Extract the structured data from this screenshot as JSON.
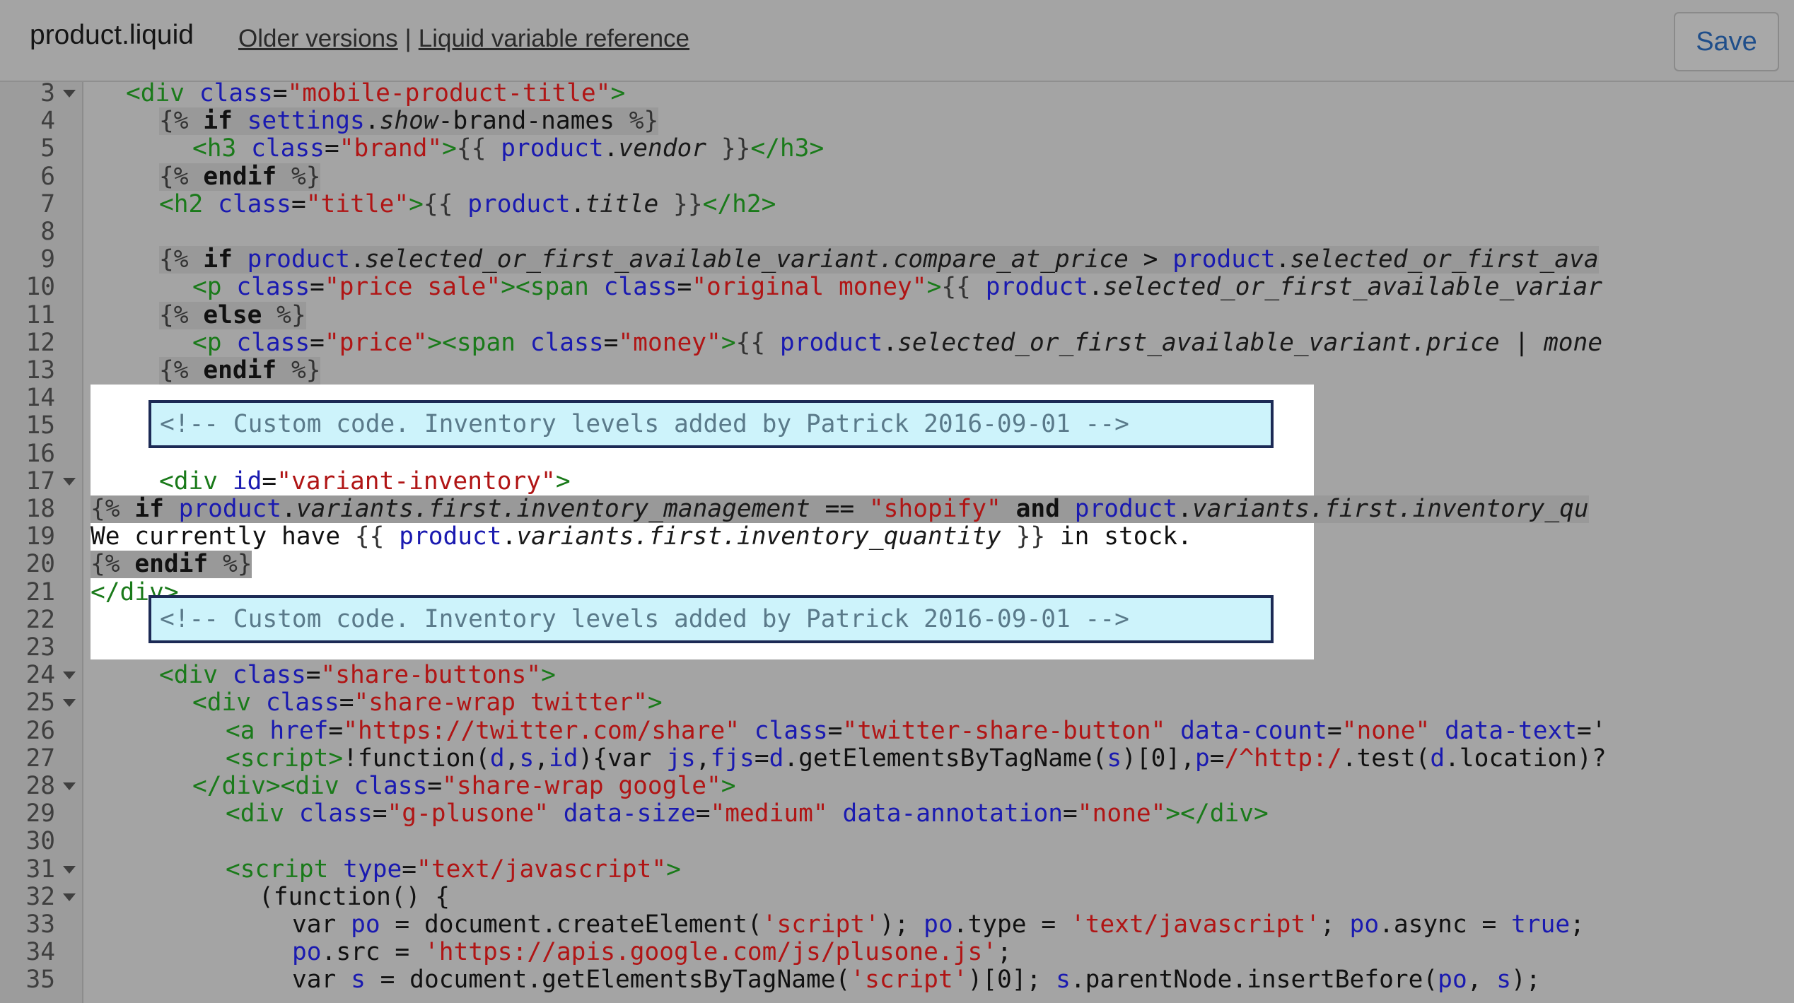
{
  "header": {
    "file_name": "product.liquid",
    "older_versions_label": "Older versions",
    "separator": "|",
    "liquid_reference_label": "Liquid variable reference",
    "save_label": "Save"
  },
  "lines": [
    {
      "n": "3",
      "fold": true,
      "parts": [
        [
          "t",
          "<div "
        ],
        [
          "a",
          "class"
        ],
        [
          "x",
          "="
        ],
        [
          "s",
          "\"mobile-product-title\""
        ],
        [
          "t",
          ">"
        ]
      ],
      "indent": 1
    },
    {
      "n": "4",
      "fold": false,
      "parts": [
        [
          "d",
          "{% "
        ],
        [
          "k",
          "if "
        ],
        [
          "v",
          "settings"
        ],
        [
          "x",
          "."
        ],
        [
          "p",
          "show"
        ],
        [
          "x",
          "-brand-names "
        ],
        [
          "d",
          "%}"
        ]
      ],
      "indent": 2,
      "bg": true
    },
    {
      "n": "5",
      "fold": false,
      "parts": [
        [
          "t",
          "<h3 "
        ],
        [
          "a",
          "class"
        ],
        [
          "x",
          "="
        ],
        [
          "s",
          "\"brand\""
        ],
        [
          "t",
          ">"
        ],
        [
          "d",
          "{{ "
        ],
        [
          "v",
          "product"
        ],
        [
          "x",
          "."
        ],
        [
          "p",
          "vendor"
        ],
        [
          "d",
          " }}"
        ],
        [
          "t",
          "</h3>"
        ]
      ],
      "indent": 3
    },
    {
      "n": "6",
      "fold": false,
      "parts": [
        [
          "d",
          "{% "
        ],
        [
          "k",
          "endif "
        ],
        [
          "d",
          "%}"
        ]
      ],
      "indent": 2,
      "bg": true
    },
    {
      "n": "7",
      "fold": false,
      "parts": [
        [
          "t",
          "<h2 "
        ],
        [
          "a",
          "class"
        ],
        [
          "x",
          "="
        ],
        [
          "s",
          "\"title\""
        ],
        [
          "t",
          ">"
        ],
        [
          "d",
          "{{ "
        ],
        [
          "v",
          "product"
        ],
        [
          "x",
          "."
        ],
        [
          "p",
          "title"
        ],
        [
          "d",
          " }}"
        ],
        [
          "t",
          "</h2>"
        ]
      ],
      "indent": 2
    },
    {
      "n": "8",
      "fold": false,
      "parts": [],
      "indent": 0
    },
    {
      "n": "9",
      "fold": false,
      "parts": [
        [
          "d",
          "{% "
        ],
        [
          "k",
          "if "
        ],
        [
          "v",
          "product"
        ],
        [
          "x",
          "."
        ],
        [
          "p",
          "selected_or_first_available_variant.compare_at_price"
        ],
        [
          "x",
          " > "
        ],
        [
          "v",
          "product"
        ],
        [
          "x",
          "."
        ],
        [
          "p",
          "selected_or_first_ava"
        ]
      ],
      "indent": 2,
      "bg": true
    },
    {
      "n": "10",
      "fold": false,
      "parts": [
        [
          "t",
          "<p "
        ],
        [
          "a",
          "class"
        ],
        [
          "x",
          "="
        ],
        [
          "s",
          "\"price sale\""
        ],
        [
          "t",
          ">"
        ],
        [
          "t",
          "<span "
        ],
        [
          "a",
          "class"
        ],
        [
          "x",
          "="
        ],
        [
          "s",
          "\"original money\""
        ],
        [
          "t",
          ">"
        ],
        [
          "d",
          "{{ "
        ],
        [
          "v",
          "product"
        ],
        [
          "x",
          "."
        ],
        [
          "p",
          "selected_or_first_available_variar"
        ]
      ],
      "indent": 3
    },
    {
      "n": "11",
      "fold": false,
      "parts": [
        [
          "d",
          "{% "
        ],
        [
          "k",
          "else "
        ],
        [
          "d",
          "%}"
        ]
      ],
      "indent": 2,
      "bg": true
    },
    {
      "n": "12",
      "fold": false,
      "parts": [
        [
          "t",
          "<p "
        ],
        [
          "a",
          "class"
        ],
        [
          "x",
          "="
        ],
        [
          "s",
          "\"price\""
        ],
        [
          "t",
          ">"
        ],
        [
          "t",
          "<span "
        ],
        [
          "a",
          "class"
        ],
        [
          "x",
          "="
        ],
        [
          "s",
          "\"money\""
        ],
        [
          "t",
          ">"
        ],
        [
          "d",
          "{{ "
        ],
        [
          "v",
          "product"
        ],
        [
          "x",
          "."
        ],
        [
          "p",
          "selected_or_first_available_variant.price"
        ],
        [
          "x",
          " | "
        ],
        [
          "p",
          "mone"
        ]
      ],
      "indent": 3
    },
    {
      "n": "13",
      "fold": false,
      "parts": [
        [
          "d",
          "{% "
        ],
        [
          "k",
          "endif "
        ],
        [
          "d",
          "%}"
        ]
      ],
      "indent": 2,
      "bg": true
    },
    {
      "n": "14",
      "fold": false,
      "parts": [],
      "indent": 0
    },
    {
      "n": "15",
      "fold": false,
      "parts": [],
      "indent": 0
    },
    {
      "n": "16",
      "fold": false,
      "parts": [],
      "indent": 0
    },
    {
      "n": "17",
      "fold": true,
      "parts": [
        [
          "t",
          "<div "
        ],
        [
          "a",
          "id"
        ],
        [
          "x",
          "="
        ],
        [
          "s",
          "\"variant-inventory\""
        ],
        [
          "t",
          ">"
        ]
      ],
      "indent": 2
    },
    {
      "n": "18",
      "fold": false,
      "parts": [
        [
          "d",
          "{% "
        ],
        [
          "k",
          "if "
        ],
        [
          "v",
          "product"
        ],
        [
          "x",
          "."
        ],
        [
          "p",
          "variants.first.inventory_management"
        ],
        [
          "x",
          " == "
        ],
        [
          "s",
          "\"shopify\""
        ],
        [
          "x",
          " "
        ],
        [
          "k",
          "and "
        ],
        [
          "v",
          "product"
        ],
        [
          "x",
          "."
        ],
        [
          "p",
          "variants.first.inventory_qu"
        ]
      ],
      "indent": 0,
      "bg": true
    },
    {
      "n": "19",
      "fold": false,
      "parts": [
        [
          "x",
          "We currently have "
        ],
        [
          "d",
          "{{ "
        ],
        [
          "v",
          "product"
        ],
        [
          "x",
          "."
        ],
        [
          "p",
          "variants.first.inventory_quantity"
        ],
        [
          "d",
          " }}"
        ],
        [
          "x",
          " in stock."
        ]
      ],
      "indent": 0
    },
    {
      "n": "20",
      "fold": false,
      "parts": [
        [
          "d",
          "{% "
        ],
        [
          "k",
          "endif "
        ],
        [
          "d",
          "%}"
        ]
      ],
      "indent": 0,
      "bg": true
    },
    {
      "n": "21",
      "fold": false,
      "parts": [
        [
          "t",
          "</div>"
        ]
      ],
      "indent": 0
    },
    {
      "n": "22",
      "fold": false,
      "parts": [],
      "indent": 0
    },
    {
      "n": "23",
      "fold": false,
      "parts": [],
      "indent": 0
    },
    {
      "n": "24",
      "fold": true,
      "parts": [
        [
          "t",
          "<div "
        ],
        [
          "a",
          "class"
        ],
        [
          "x",
          "="
        ],
        [
          "s",
          "\"share-buttons\""
        ],
        [
          "t",
          ">"
        ]
      ],
      "indent": 2
    },
    {
      "n": "25",
      "fold": true,
      "parts": [
        [
          "t",
          "<div "
        ],
        [
          "a",
          "class"
        ],
        [
          "x",
          "="
        ],
        [
          "s",
          "\"share-wrap twitter\""
        ],
        [
          "t",
          ">"
        ]
      ],
      "indent": 3
    },
    {
      "n": "26",
      "fold": false,
      "parts": [
        [
          "t",
          "<a "
        ],
        [
          "a",
          "href"
        ],
        [
          "x",
          "="
        ],
        [
          "s",
          "\"https://twitter.com/share\""
        ],
        [
          "x",
          " "
        ],
        [
          "a",
          "class"
        ],
        [
          "x",
          "="
        ],
        [
          "s",
          "\"twitter-share-button\""
        ],
        [
          "x",
          " "
        ],
        [
          "a",
          "data-count"
        ],
        [
          "x",
          "="
        ],
        [
          "s",
          "\"none\""
        ],
        [
          "x",
          " "
        ],
        [
          "a",
          "data-text"
        ],
        [
          "x",
          "='"
        ]
      ],
      "indent": 4
    },
    {
      "n": "27",
      "fold": false,
      "parts": [
        [
          "t",
          "<script>"
        ],
        [
          "x",
          "!function("
        ],
        [
          "v",
          "d"
        ],
        [
          "x",
          ","
        ],
        [
          "v",
          "s"
        ],
        [
          "x",
          ","
        ],
        [
          "v",
          "id"
        ],
        [
          "x",
          "){var "
        ],
        [
          "v",
          "js"
        ],
        [
          "x",
          ","
        ],
        [
          "v",
          "fjs"
        ],
        [
          "x",
          "="
        ],
        [
          "v",
          "d"
        ],
        [
          "x",
          ".getElementsByTagName("
        ],
        [
          "v",
          "s"
        ],
        [
          "x",
          ")[0],"
        ],
        [
          "v",
          "p"
        ],
        [
          "x",
          "="
        ],
        [
          "s",
          "/^http:/"
        ],
        [
          "x",
          ".test("
        ],
        [
          "v",
          "d"
        ],
        [
          "x",
          ".location)?"
        ]
      ],
      "indent": 4
    },
    {
      "n": "28",
      "fold": true,
      "parts": [
        [
          "t",
          "</div><div "
        ],
        [
          "a",
          "class"
        ],
        [
          "x",
          "="
        ],
        [
          "s",
          "\"share-wrap google\""
        ],
        [
          "t",
          ">"
        ]
      ],
      "indent": 3
    },
    {
      "n": "29",
      "fold": false,
      "parts": [
        [
          "t",
          "<div "
        ],
        [
          "a",
          "class"
        ],
        [
          "x",
          "="
        ],
        [
          "s",
          "\"g-plusone\""
        ],
        [
          "x",
          " "
        ],
        [
          "a",
          "data-size"
        ],
        [
          "x",
          "="
        ],
        [
          "s",
          "\"medium\""
        ],
        [
          "x",
          " "
        ],
        [
          "a",
          "data-annotation"
        ],
        [
          "x",
          "="
        ],
        [
          "s",
          "\"none\""
        ],
        [
          "t",
          "></div>"
        ]
      ],
      "indent": 4
    },
    {
      "n": "30",
      "fold": false,
      "parts": [],
      "indent": 0
    },
    {
      "n": "31",
      "fold": true,
      "parts": [
        [
          "t",
          "<script "
        ],
        [
          "a",
          "type"
        ],
        [
          "x",
          "="
        ],
        [
          "s",
          "\"text/javascript\""
        ],
        [
          "t",
          ">"
        ]
      ],
      "indent": 4
    },
    {
      "n": "32",
      "fold": true,
      "parts": [
        [
          "x",
          "(function() {"
        ]
      ],
      "indent": 5
    },
    {
      "n": "33",
      "fold": false,
      "parts": [
        [
          "x",
          "var "
        ],
        [
          "v",
          "po"
        ],
        [
          "x",
          " = document.createElement("
        ],
        [
          "s",
          "'script'"
        ],
        [
          "x",
          "); "
        ],
        [
          "v",
          "po"
        ],
        [
          "x",
          ".type = "
        ],
        [
          "s",
          "'text/javascript'"
        ],
        [
          "x",
          "; "
        ],
        [
          "v",
          "po"
        ],
        [
          "x",
          ".async = "
        ],
        [
          "v",
          "true"
        ],
        [
          "x",
          ";"
        ]
      ],
      "indent": 6
    },
    {
      "n": "34",
      "fold": false,
      "parts": [
        [
          "v",
          "po"
        ],
        [
          "x",
          ".src = "
        ],
        [
          "s",
          "'https://apis.google.com/js/plusone.js'"
        ],
        [
          "x",
          ";"
        ]
      ],
      "indent": 6
    },
    {
      "n": "35",
      "fold": false,
      "parts": [
        [
          "x",
          "var "
        ],
        [
          "v",
          "s"
        ],
        [
          "x",
          " = document.getElementsByTagName("
        ],
        [
          "s",
          "'script'"
        ],
        [
          "x",
          ")[0]; "
        ],
        [
          "v",
          "s"
        ],
        [
          "x",
          ".parentNode.insertBefore("
        ],
        [
          "v",
          "po"
        ],
        [
          "x",
          ", "
        ],
        [
          "v",
          "s"
        ],
        [
          "x",
          ");"
        ]
      ],
      "indent": 6
    }
  ],
  "comment_text": "<!-- Custom code. Inventory levels added by Patrick 2016-09-01 -->"
}
